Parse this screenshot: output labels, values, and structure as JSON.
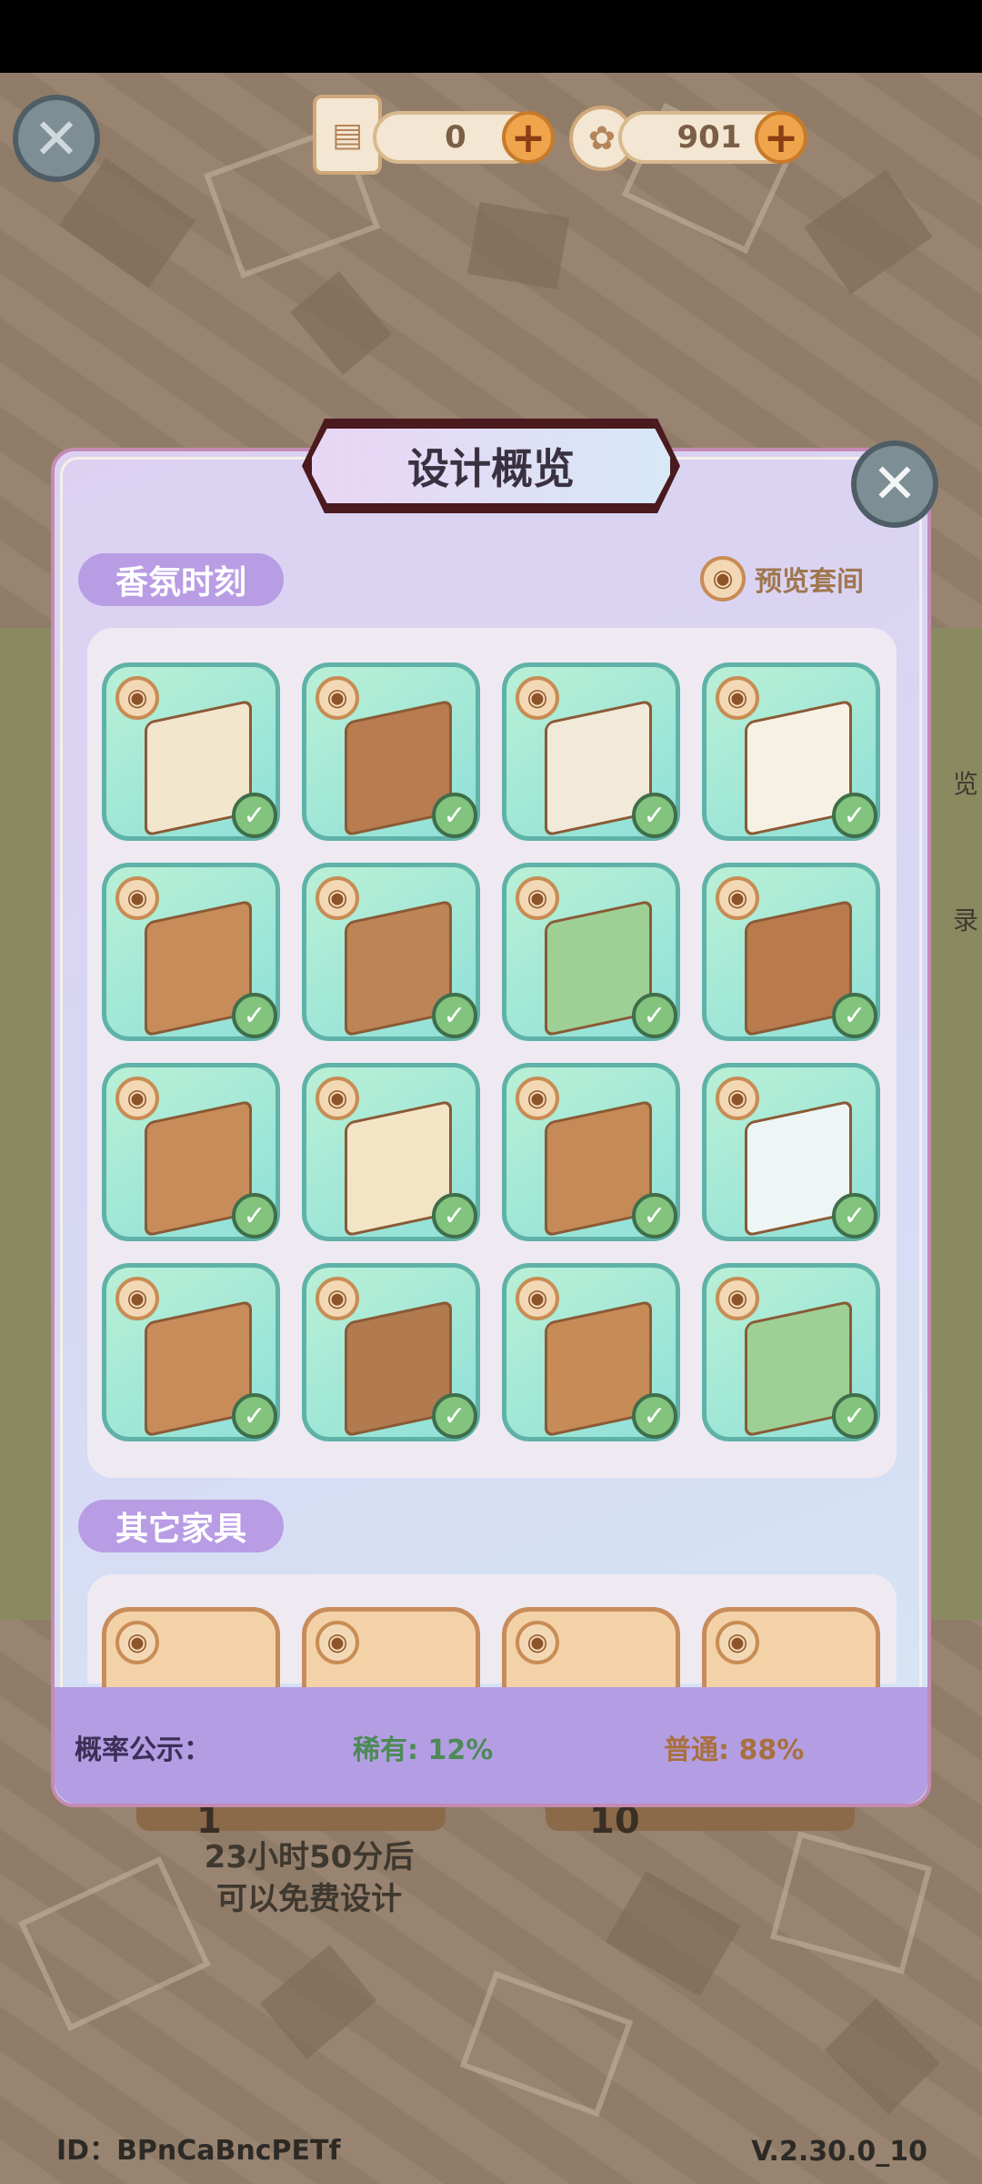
{
  "currency": {
    "scroll_value": "0",
    "coin_value": "901"
  },
  "modal": {
    "title": "设计概览",
    "section1": "香氛时刻",
    "preview_suite": "预览套间",
    "section2": "其它家具",
    "probability_label": "概率公示：",
    "rare": "稀有: 12%",
    "common": "普通: 88%"
  },
  "items_section1": [
    {
      "name": "floor-tile"
    },
    {
      "name": "cabinet"
    },
    {
      "name": "sink-counter"
    },
    {
      "name": "bathtub"
    },
    {
      "name": "vanity"
    },
    {
      "name": "shelf-cabinet"
    },
    {
      "name": "shower-screen"
    },
    {
      "name": "toilet"
    },
    {
      "name": "tall-shelf"
    },
    {
      "name": "wall-panel"
    },
    {
      "name": "washer-cabinet"
    },
    {
      "name": "mirror"
    },
    {
      "name": "display-cabinet"
    },
    {
      "name": "blinds"
    },
    {
      "name": "storage-rack"
    },
    {
      "name": "shower-panel"
    }
  ],
  "background": {
    "side_text_1": "览",
    "side_text_2": "录",
    "cost_left": "1",
    "cost_right": "10",
    "free_text_line1": "23小时50分后",
    "free_text_line2": "可以免费设计",
    "id_text": "ID：BPnCaBncPETf",
    "version": "V.2.30.0_10"
  },
  "colors": {
    "tile_green": "#8fe0d8",
    "rare": "#4d8a56",
    "common": "#a8703e",
    "pill": "#b89ce4"
  }
}
